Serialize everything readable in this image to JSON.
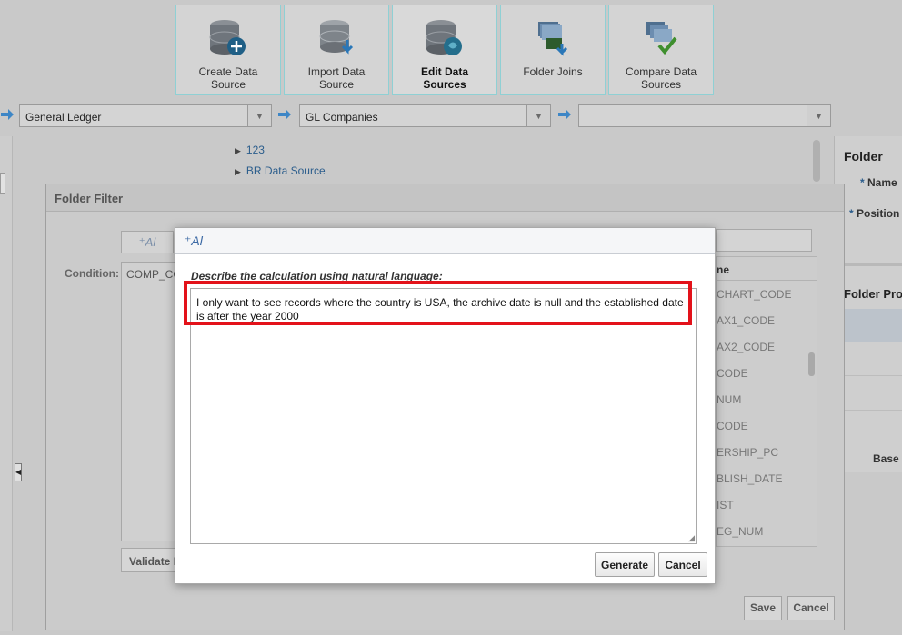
{
  "toolbar": {
    "buttons": [
      {
        "label": "Create Data Source",
        "icon": "database-add-icon",
        "active": false
      },
      {
        "label": "Import Data Source",
        "icon": "database-import-icon",
        "active": false
      },
      {
        "label": "Edit Data Sources",
        "icon": "database-edit-icon",
        "active": true
      },
      {
        "label": "Folder Joins",
        "icon": "folder-joins-icon",
        "active": false
      },
      {
        "label": "Compare Data Sources",
        "icon": "compare-icon",
        "active": false
      }
    ]
  },
  "selectors": {
    "first": "General Ledger",
    "second": "GL Companies",
    "third": ""
  },
  "tree": {
    "items": [
      "123",
      "BR Data Source"
    ]
  },
  "right_panel": {
    "folder_title": "Folder",
    "name_label": "Name",
    "position_label": "Position",
    "folder_props": "Folder Pro",
    "base_label": "Base"
  },
  "folder_filter": {
    "title": "Folder Filter",
    "ai_button": "⁺Al",
    "condition_label": "Condition:",
    "condition_value": "COMP_CC",
    "validate_button": "Validate F",
    "column_header": "ne",
    "columns": [
      "CHART_CODE",
      "AX1_CODE",
      "AX2_CODE",
      "CODE",
      "NUM",
      "CODE",
      "ERSHIP_PC",
      "BLISH_DATE",
      "IST",
      "EG_NUM"
    ],
    "save_button": "Save",
    "cancel_button": "Cancel"
  },
  "ai_modal": {
    "header": "⁺Al",
    "prompt_label": "Describe the calculation using natural language:",
    "text": "I only want to see records where the country is USA, the archive date is null and the established date is after the year 2000",
    "generate_button": "Generate",
    "cancel_button": "Cancel"
  },
  "colors": {
    "accent": "#3d6aa5",
    "highlight": "#e3121a",
    "link": "#2b5d8c"
  }
}
